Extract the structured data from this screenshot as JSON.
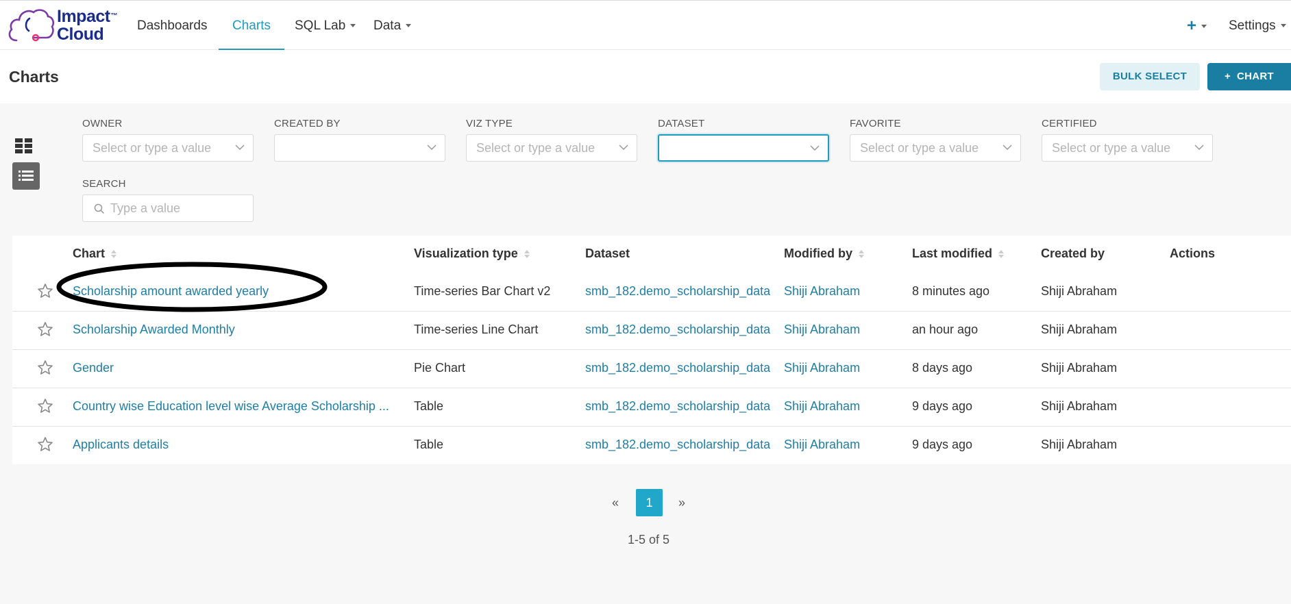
{
  "brand": {
    "name_line1": "Impact",
    "name_line2": "Cloud",
    "tm": "™"
  },
  "nav": {
    "dashboards": "Dashboards",
    "charts": "Charts",
    "sql_lab": "SQL Lab",
    "data": "Data",
    "plus_icon": "plus-icon",
    "settings": "Settings"
  },
  "header": {
    "title": "Charts",
    "bulk_select": "BULK SELECT",
    "add_chart": "CHART"
  },
  "filters": {
    "owner": {
      "label": "OWNER",
      "placeholder": "Select or type a value"
    },
    "created_by": {
      "label": "CREATED BY",
      "placeholder": ""
    },
    "viz_type": {
      "label": "VIZ TYPE",
      "placeholder": "Select or type a value"
    },
    "dataset": {
      "label": "DATASET",
      "placeholder": ""
    },
    "favorite": {
      "label": "FAVORITE",
      "placeholder": "Select or type a value"
    },
    "certified": {
      "label": "CERTIFIED",
      "placeholder": "Select or type a value"
    },
    "search": {
      "label": "SEARCH",
      "placeholder": "Type a value"
    }
  },
  "table": {
    "columns": {
      "chart": "Chart",
      "viz_type": "Visualization type",
      "dataset": "Dataset",
      "modified_by": "Modified by",
      "last_modified": "Last modified",
      "created_by": "Created by",
      "actions": "Actions"
    },
    "rows": [
      {
        "chart": "Scholarship amount awarded yearly",
        "viz_type": "Time-series Bar Chart v2",
        "dataset": "smb_182.demo_scholarship_data",
        "modified_by": "Shiji Abraham",
        "last_modified": "8 minutes ago",
        "created_by": "Shiji Abraham"
      },
      {
        "chart": "Scholarship Awarded Monthly",
        "viz_type": "Time-series Line Chart",
        "dataset": "smb_182.demo_scholarship_data",
        "modified_by": "Shiji Abraham",
        "last_modified": "an hour ago",
        "created_by": "Shiji Abraham"
      },
      {
        "chart": "Gender",
        "viz_type": "Pie Chart",
        "dataset": "smb_182.demo_scholarship_data",
        "modified_by": "Shiji Abraham",
        "last_modified": "8 days ago",
        "created_by": "Shiji Abraham"
      },
      {
        "chart": "Country wise Education level wise Average Scholarship ...",
        "viz_type": "Table",
        "dataset": "smb_182.demo_scholarship_data",
        "modified_by": "Shiji Abraham",
        "last_modified": "9 days ago",
        "created_by": "Shiji Abraham"
      },
      {
        "chart": "Applicants details",
        "viz_type": "Table",
        "dataset": "smb_182.demo_scholarship_data",
        "modified_by": "Shiji Abraham",
        "last_modified": "9 days ago",
        "created_by": "Shiji Abraham"
      }
    ]
  },
  "pagination": {
    "prev": "«",
    "current": "1",
    "next": "»",
    "summary": "1-5 of 5"
  },
  "colors": {
    "accent": "#1f9bbf",
    "primary_button": "#1a7ea3",
    "link": "#1f7ea6",
    "brand": "#1a2d8a"
  }
}
